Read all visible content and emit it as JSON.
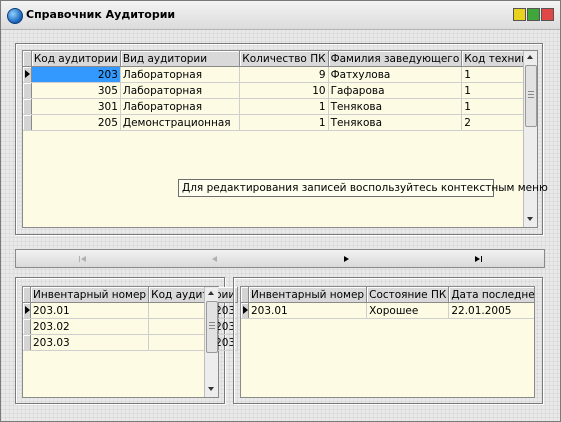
{
  "window": {
    "title": "Справочник Аудитории"
  },
  "auditoriums": {
    "columns": [
      "Код аудитории",
      "Вид аудитории",
      "Количество ПК",
      "Фамилия заведующего",
      "Код техника"
    ],
    "rows": [
      [
        "203",
        "Лабораторная",
        "9",
        "Фатхулова",
        "1"
      ],
      [
        "305",
        "Лабораторная",
        "10",
        "Гафарова",
        "1"
      ],
      [
        "301",
        "Лабораторная",
        "1",
        "Тенякова",
        "1"
      ],
      [
        "205",
        "Демонстрационная",
        "1",
        "Тенякова",
        "2"
      ]
    ],
    "selected_row": 0
  },
  "tooltip": "Для редактирования записей воспользуйтесь контекстным меню",
  "navigator": {
    "buttons": [
      "first",
      "prior",
      "next",
      "last"
    ]
  },
  "inventory": {
    "columns": [
      "Инвентарный номер",
      "Код аудитории"
    ],
    "rows": [
      [
        "203.01",
        "203"
      ],
      [
        "203.02",
        "203"
      ],
      [
        "203.03",
        "203"
      ]
    ]
  },
  "inspection": {
    "columns": [
      "Инвентарный номер",
      "Состояние ПК",
      "Дата последнего осмотра"
    ],
    "rows": [
      [
        "203.01",
        "Хорошее",
        "22.01.2005"
      ]
    ]
  },
  "colors": {
    "grid_bg": "#fdfbe4",
    "selection": "#3399ff",
    "minimize": "#e8d21e",
    "maximize": "#3fa63a",
    "close": "#e04848"
  }
}
